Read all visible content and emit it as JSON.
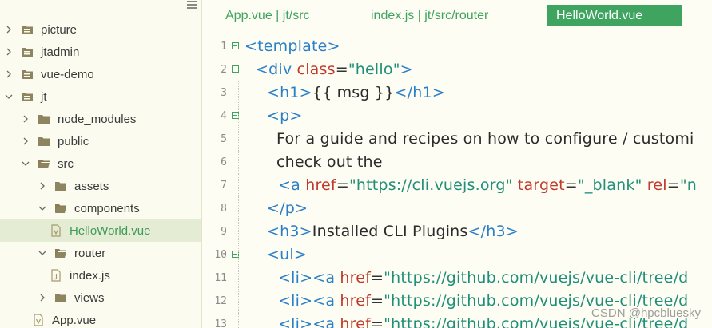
{
  "sidebar": {
    "items": [
      {
        "label": "picture",
        "kind": "folder",
        "expanded": false
      },
      {
        "label": "jtadmin",
        "kind": "folder",
        "expanded": false
      },
      {
        "label": "vue-demo",
        "kind": "folder",
        "expanded": false
      },
      {
        "label": "jt",
        "kind": "folder",
        "expanded": true
      },
      {
        "label": "node_modules",
        "kind": "folder",
        "expanded": false
      },
      {
        "label": "public",
        "kind": "folder",
        "expanded": false
      },
      {
        "label": "src",
        "kind": "folder",
        "expanded": true
      },
      {
        "label": "assets",
        "kind": "folder",
        "expanded": false
      },
      {
        "label": "components",
        "kind": "folder",
        "expanded": true
      },
      {
        "label": "HelloWorld.vue",
        "kind": "vue-file",
        "selected": true
      },
      {
        "label": "router",
        "kind": "folder",
        "expanded": true
      },
      {
        "label": "index.js",
        "kind": "js-file"
      },
      {
        "label": "views",
        "kind": "folder",
        "expanded": false
      },
      {
        "label": "App.vue",
        "kind": "vue-file"
      }
    ]
  },
  "tabs": [
    {
      "label": "App.vue | jt/src",
      "active": false
    },
    {
      "label": "index.js | jt/src/router",
      "active": false
    },
    {
      "label": "HelloWorld.vue",
      "active": true
    }
  ],
  "editor": {
    "lines": [
      {
        "n": "1",
        "t": [
          [
            "tg",
            "<template>"
          ]
        ]
      },
      {
        "n": "2",
        "t": [
          [
            "tg",
            "<div "
          ],
          [
            "at",
            "class"
          ],
          [
            "eq",
            "="
          ],
          [
            "st",
            "\"hello\""
          ],
          [
            "tg",
            ">"
          ]
        ]
      },
      {
        "n": "3",
        "t": [
          [
            "tg",
            "<h1>"
          ],
          [
            "tx",
            "{{ msg }}"
          ],
          [
            "tg",
            "</h1>"
          ]
        ]
      },
      {
        "n": "4",
        "t": [
          [
            "tg",
            "<p>"
          ]
        ]
      },
      {
        "n": "5",
        "t": [
          [
            "tx",
            "For a guide and recipes on how to configure / customi"
          ]
        ]
      },
      {
        "n": "6",
        "t": [
          [
            "tx",
            "check out the"
          ]
        ]
      },
      {
        "n": "7",
        "t": [
          [
            "tg",
            "<a "
          ],
          [
            "at",
            "href"
          ],
          [
            "eq",
            "="
          ],
          [
            "st",
            "\"https://cli.vuejs.org\""
          ],
          [
            "tx",
            " "
          ],
          [
            "at",
            "target"
          ],
          [
            "eq",
            "="
          ],
          [
            "st",
            "\"_blank\""
          ],
          [
            "tx",
            " "
          ],
          [
            "at",
            "rel"
          ],
          [
            "eq",
            "="
          ],
          [
            "st",
            "\"n"
          ]
        ]
      },
      {
        "n": "8",
        "t": [
          [
            "tg",
            "</p>"
          ]
        ]
      },
      {
        "n": "9",
        "t": [
          [
            "tg",
            "<h3>"
          ],
          [
            "tx",
            "Installed CLI Plugins"
          ],
          [
            "tg",
            "</h3>"
          ]
        ]
      },
      {
        "n": "10",
        "t": [
          [
            "tg",
            "<ul>"
          ]
        ]
      },
      {
        "n": "11",
        "t": [
          [
            "tg",
            "<li><a "
          ],
          [
            "at",
            "href"
          ],
          [
            "eq",
            "="
          ],
          [
            "st",
            "\"https://github.com/vuejs/vue-cli/tree/d"
          ]
        ]
      },
      {
        "n": "12",
        "t": [
          [
            "tg",
            "<li><a "
          ],
          [
            "at",
            "href"
          ],
          [
            "eq",
            "="
          ],
          [
            "st",
            "\"https://github.com/vuejs/vue-cli/tree/d"
          ]
        ]
      },
      {
        "n": "13",
        "t": [
          [
            "tg",
            "<li><a "
          ],
          [
            "at",
            "href"
          ],
          [
            "eq",
            "="
          ],
          [
            "st",
            "\"https://github.com/vuejs/vue-cli/tree/d"
          ]
        ]
      }
    ]
  },
  "watermark": "CSDN @hpcbluesky",
  "colors": {
    "accent": "#3ea45f",
    "tag": "#2a7fc8",
    "attribute": "#c0392b",
    "string": "#1f8f7a",
    "background": "#fdfdf3"
  }
}
